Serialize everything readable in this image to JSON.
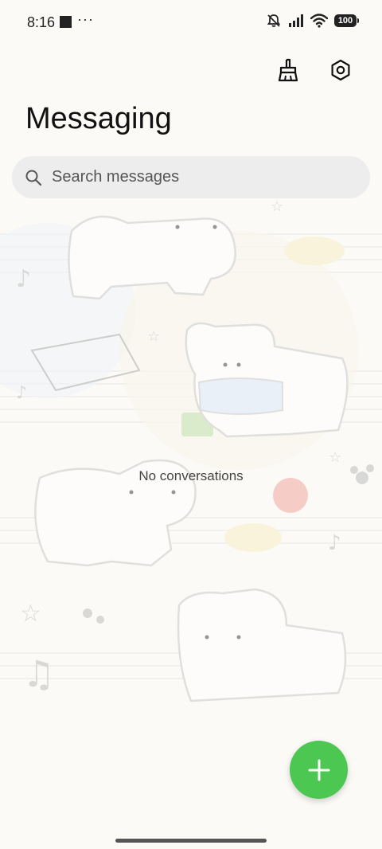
{
  "status_bar": {
    "time": "8:16",
    "dots": "···",
    "battery": "100"
  },
  "header": {
    "title": "Messaging",
    "clean_icon": "broom-icon",
    "settings_icon": "settings-icon"
  },
  "search": {
    "placeholder": "Search messages"
  },
  "main": {
    "empty_state": "No conversations"
  },
  "fab": {
    "icon": "plus-icon",
    "color": "#4cc752"
  }
}
